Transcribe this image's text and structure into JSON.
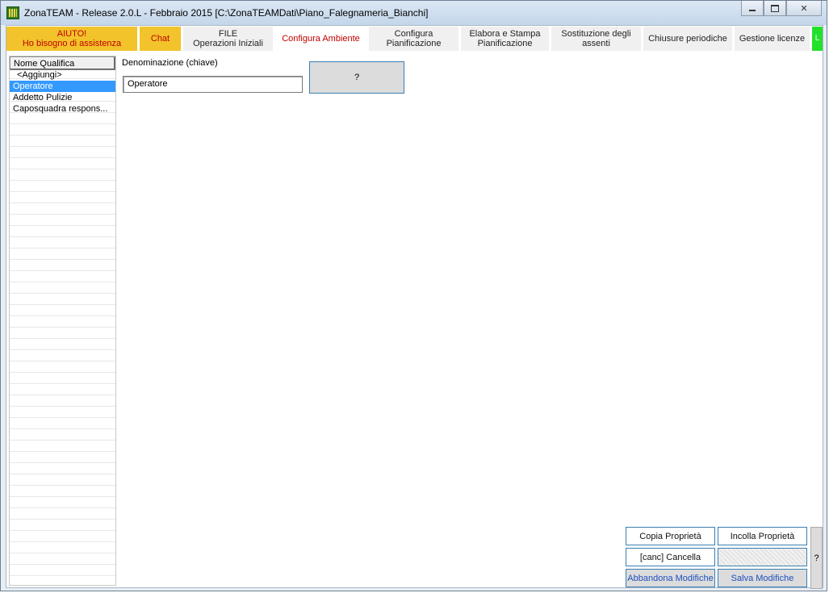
{
  "window": {
    "title": "ZonaTEAM - Release 2.0.L - Febbraio 2015 [C:\\ZonaTEAMDati\\Piano_Falegnameria_Bianchi]"
  },
  "tabs": {
    "help_line1": "AIUTO!",
    "help_line2": "Ho bisogno di assistenza",
    "chat": "Chat",
    "file_line1": "FILE",
    "file_line2": "Operazioni Iniziali",
    "configura_ambiente": "Configura Ambiente",
    "configura_pian_line1": "Configura",
    "configura_pian_line2": "Pianificazione",
    "elabora_line1": "Elabora e Stampa",
    "elabora_line2": "Pianificazione",
    "sostituzione_line1": "Sostituzione degli",
    "sostituzione_line2": "assenti",
    "chiusure": "Chiusure periodiche",
    "licenze": "Gestione licenze",
    "license_indicator": "L"
  },
  "qualifiche": {
    "header": "Nome Qualifica",
    "items": [
      "<Aggiungi>",
      "Operatore",
      "Addetto Pulizie",
      "Caposquadra respons..."
    ]
  },
  "editor": {
    "label": "Denominazione (chiave)",
    "value": "Operatore",
    "help_button": "?"
  },
  "actions": {
    "copia": "Copia Proprietà",
    "incolla": "Incolla Proprietà",
    "cancella": "[canc] Cancella",
    "abbandona": "Abbandona Modifiche",
    "salva": "Salva Modifiche",
    "side_help": "?"
  }
}
